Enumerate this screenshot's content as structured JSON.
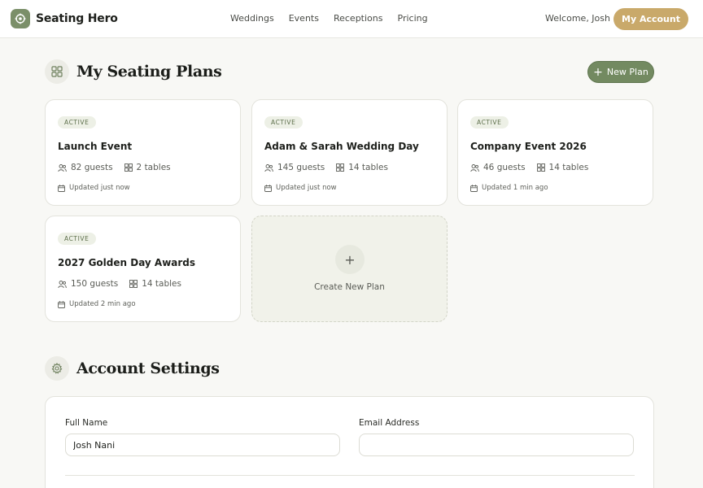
{
  "brand": {
    "name": "Seating Hero"
  },
  "nav": [
    "Weddings",
    "Events",
    "Receptions",
    "Pricing"
  ],
  "header": {
    "welcome": "Welcome, Josh",
    "account_button": "My Account"
  },
  "plans_section": {
    "title": "My Seating Plans",
    "new_plan_label": "New Plan"
  },
  "plans": [
    {
      "status": "ACTIVE",
      "name": "Launch Event",
      "guests": "82 guests",
      "tables": "2 tables",
      "updated": "Updated just now"
    },
    {
      "status": "ACTIVE",
      "name": "Adam & Sarah Wedding Day",
      "guests": "145 guests",
      "tables": "14 tables",
      "updated": "Updated just now"
    },
    {
      "status": "ACTIVE",
      "name": "Company Event 2026",
      "guests": "46 guests",
      "tables": "14 tables",
      "updated": "Updated 1 min ago"
    },
    {
      "status": "ACTIVE",
      "name": "2027 Golden Day Awards",
      "guests": "150 guests",
      "tables": "14 tables",
      "updated": "Updated 2 min ago"
    }
  ],
  "create_plan": {
    "label": "Create New Plan"
  },
  "settings": {
    "title": "Account Settings",
    "full_name_label": "Full Name",
    "full_name_value": "Josh Nani",
    "email_label": "Email Address",
    "email_value": ""
  },
  "colors": {
    "accent_green": "#738a61",
    "gold": "#c9a96a",
    "background": "#f8f8f5"
  },
  "icons": {
    "brand": "target-icon",
    "plans": "grid-icon",
    "settings": "gear-icon",
    "guests": "users-icon",
    "tables": "grid-icon",
    "updated": "calendar-icon"
  }
}
